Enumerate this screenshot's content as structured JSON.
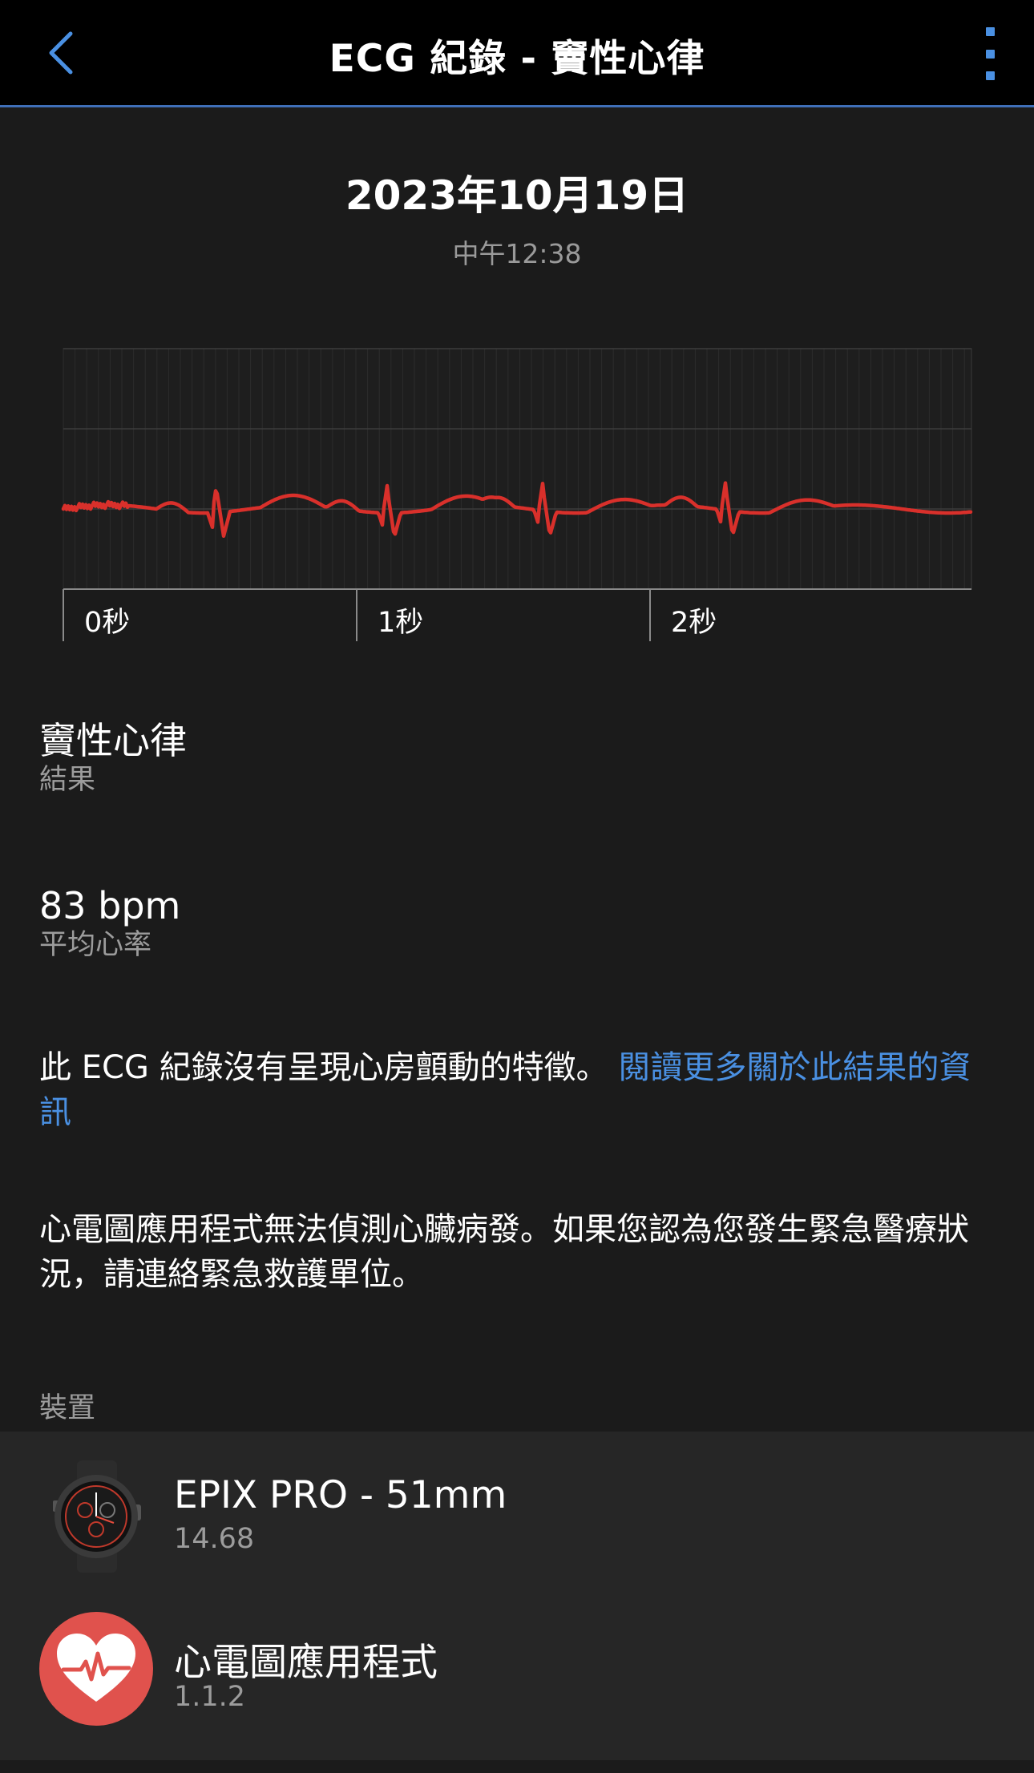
{
  "header": {
    "title": "ECG 紀錄 - 竇性心律",
    "accent_color": "#4a90e2"
  },
  "record": {
    "date": "2023年10月19日",
    "time": "中午12:38"
  },
  "ecg": {
    "tick_labels": [
      "0秒",
      "1秒",
      "2秒"
    ],
    "trace_color": "#d9302b"
  },
  "result": {
    "value": "竇性心律",
    "label": "結果"
  },
  "heart_rate": {
    "value": "83 bpm",
    "label": "平均心率"
  },
  "notice": {
    "text": "此 ECG 紀錄沒有呈現心房顫動的特徵。 ",
    "link": "閱讀更多關於此結果的資訊"
  },
  "disclaimer": "心電圖應用程式無法偵測心臟病發。如果您認為您發生緊急醫療狀況，請連絡緊急救護單位。",
  "devices": {
    "section_label": "裝置",
    "items": [
      {
        "name": "EPIX PRO - 51mm",
        "version": "14.68",
        "icon": "watch-icon"
      },
      {
        "name": "心電圖應用程式",
        "version": "1.1.2",
        "icon": "heart-ecg-icon"
      }
    ]
  }
}
